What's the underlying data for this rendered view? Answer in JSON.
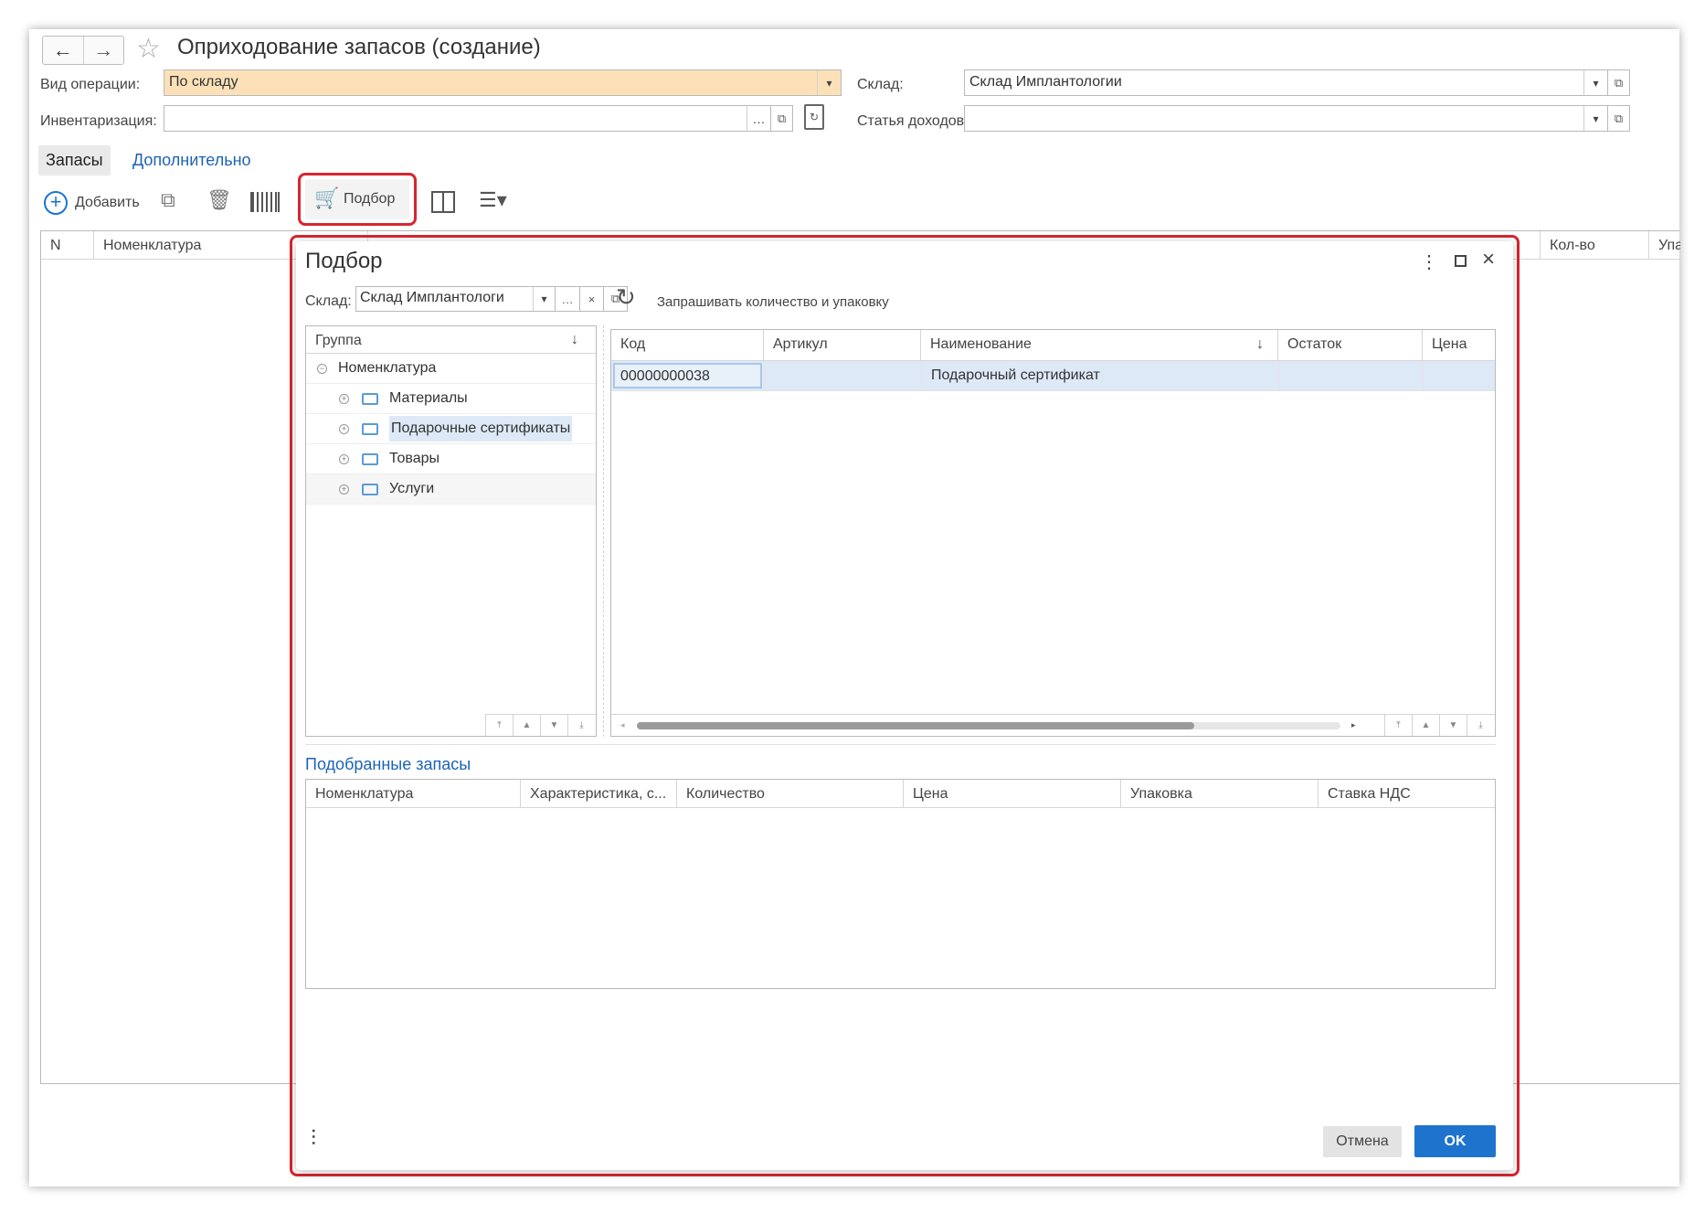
{
  "window": {
    "title": "Оприходование запасов (создание)",
    "nav_back": "←",
    "nav_forward": "→",
    "favorite_icon": "☆"
  },
  "form": {
    "operation_label": "Вид операции:",
    "operation_value": "По складу",
    "warehouse_label": "Склад:",
    "warehouse_value": "Склад Имплантологии",
    "inventory_label": "Инвентаризация:",
    "inventory_value": "",
    "income_item_label": "Статья доходов:",
    "income_item_value": ""
  },
  "tabs": [
    {
      "label": "Запасы",
      "active": true
    },
    {
      "label": "Дополнительно",
      "active": false
    }
  ],
  "toolbar": {
    "add_label": "Добавить",
    "pick_label": "Подбор"
  },
  "main_table": {
    "columns": [
      "N",
      "Номенклатура",
      "Кол-во",
      "Упа"
    ]
  },
  "dialog": {
    "title": "Подбор",
    "warehouse_label": "Склад:",
    "warehouse_value": "Склад Имплантологи",
    "ask_qty_label": "Запрашивать количество и упаковку",
    "tree": {
      "header": "Группа",
      "sort_icon": "↓",
      "root": "Номенклатура",
      "items": [
        "Материалы",
        "Подарочные сертификаты",
        "Товары",
        "Услуги"
      ],
      "selected_index": 1
    },
    "list": {
      "columns": [
        "Код",
        "Артикул",
        "Наименование",
        "Остаток",
        "Цена"
      ],
      "rows": [
        {
          "code": "00000000038",
          "article": "",
          "name": "Подарочный сертификат",
          "rest": "",
          "price": ""
        }
      ]
    },
    "picked": {
      "title": "Подобранные запасы",
      "columns": [
        "Номенклатура",
        "Характеристика, с...",
        "Количество",
        "Цена",
        "Упаковка",
        "Ставка НДС"
      ]
    },
    "cancel_label": "Отмена",
    "ok_label": "OK"
  },
  "colors": {
    "accent": "#1e74cd",
    "highlight": "#d7262f",
    "operation_bg": "#fce1b8",
    "selection": "#dde9f6"
  }
}
